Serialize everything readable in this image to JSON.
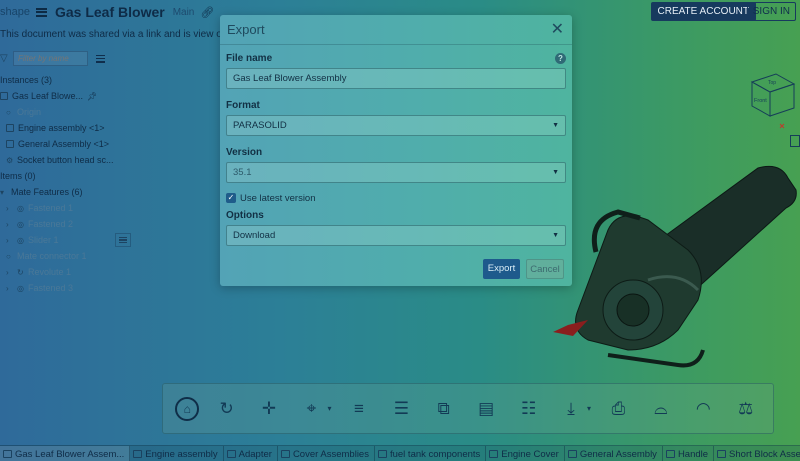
{
  "header": {
    "brand": "shape",
    "title": "Gas Leaf Blower",
    "branch": "Main",
    "create_account": "CREATE ACCOUNT",
    "sign_in": "SIGN IN"
  },
  "notice": "This document was shared via a link and is view only.",
  "left_panel": {
    "filter_placeholder": "Filter by name",
    "tree": [
      {
        "label": "Instances (3)",
        "kind": "section"
      },
      {
        "label": "Gas Leaf Blowe...",
        "kind": "root"
      },
      {
        "label": "Origin",
        "kind": "dim"
      },
      {
        "label": "Engine assembly <1>",
        "kind": "item"
      },
      {
        "label": "General Assembly <1>",
        "kind": "item"
      },
      {
        "label": "Socket button head sc...",
        "kind": "item"
      },
      {
        "label": "Items (0)",
        "kind": "section"
      },
      {
        "label": "Mate Features (6)",
        "kind": "section"
      },
      {
        "label": "Fastened 1",
        "kind": "mate"
      },
      {
        "label": "Fastened 2",
        "kind": "mate"
      },
      {
        "label": "Slider 1",
        "kind": "mate"
      },
      {
        "label": "Mate connector 1",
        "kind": "dim"
      },
      {
        "label": "Revolute 1",
        "kind": "mate"
      },
      {
        "label": "Fastened 3",
        "kind": "mate"
      }
    ]
  },
  "view_cube": {
    "front": "Front",
    "top": "Top"
  },
  "dialog": {
    "title": "Export",
    "file_name_label": "File name",
    "file_name_value": "Gas Leaf Blower Assembly",
    "format_label": "Format",
    "format_value": "PARASOLID",
    "version_label": "Version",
    "version_value": "35.1",
    "use_latest_label": "Use latest version",
    "options_label": "Options",
    "options_value": "Download",
    "export_button": "Export",
    "cancel_button": "Cancel"
  },
  "tabs": [
    {
      "label": "Gas Leaf Blower Assem...",
      "active": true
    },
    {
      "label": "Engine assembly",
      "active": false
    },
    {
      "label": "Adapter",
      "active": false
    },
    {
      "label": "Cover Assemblies",
      "active": false
    },
    {
      "label": "fuel tank components",
      "active": false
    },
    {
      "label": "Engine Cover",
      "active": false
    },
    {
      "label": "General Assembly",
      "active": false
    },
    {
      "label": "Handle",
      "active": false
    },
    {
      "label": "Short Block Assembly",
      "active": false
    }
  ],
  "colors": {
    "accent": "#1e5a8c",
    "overlay_left": "#2f6a9a",
    "overlay_right": "#47a052"
  }
}
